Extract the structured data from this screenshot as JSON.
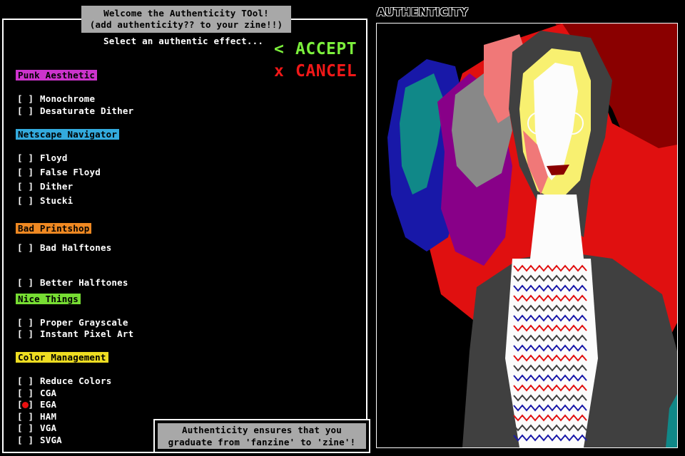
{
  "welcome": {
    "line1": "Welcome the Authenticity TOol!",
    "line2": "(add authenticity?? to your zine!!)"
  },
  "prompt": "Select an authentic effect...",
  "actions": {
    "accept_glyph": "<",
    "accept_label": "ACCEPT",
    "accept_color": "#7cf03c",
    "cancel_glyph": "x",
    "cancel_label": "CANCEL",
    "cancel_color": "#f01818"
  },
  "checkbox_text": "[ ]",
  "checkbox_checked_left": "[",
  "checkbox_checked_right": "]",
  "sections": [
    {
      "label": "Punk Aesthetic",
      "color": "#cc33cc"
    },
    {
      "label": "Netscape Navigator",
      "color": "#33aadd"
    },
    {
      "label": "Bad Printshop",
      "color": "#ee8822"
    },
    {
      "label": "Nice Things",
      "color": "#77dd33"
    },
    {
      "label": "Color Management",
      "color": "#eedd22"
    }
  ],
  "options": {
    "monochrome": {
      "label": "Monochrome",
      "checked": false
    },
    "desaturate_dither": {
      "label": "Desaturate Dither",
      "checked": false
    },
    "floyd": {
      "label": "Floyd",
      "checked": false
    },
    "false_floyd": {
      "label": "False Floyd",
      "checked": false
    },
    "dither": {
      "label": "Dither",
      "checked": false
    },
    "stucki": {
      "label": "Stucki",
      "checked": false
    },
    "bad_halftones": {
      "label": "Bad Halftones",
      "checked": false
    },
    "better_halftones": {
      "label": "Better Halftones",
      "checked": false
    },
    "proper_grayscale": {
      "label": "Proper Grayscale",
      "checked": false
    },
    "instant_pixel_art": {
      "label": "Instant Pixel Art",
      "checked": false
    },
    "reduce_colors": {
      "label": "Reduce Colors",
      "checked": false
    },
    "cga": {
      "label": "CGA",
      "checked": false
    },
    "ega": {
      "label": "EGA",
      "checked": true
    },
    "ham": {
      "label": "HAM",
      "checked": false
    },
    "vga": {
      "label": "VGA",
      "checked": false
    },
    "svga": {
      "label": "SVGA",
      "checked": false
    }
  },
  "footer": {
    "line1": "Authenticity ensures that you",
    "line2": "graduate from 'fanzine' to 'zine'!"
  },
  "brand": "AUTHENTICITY",
  "preview": {
    "alt": "preview-image",
    "palette": {
      "background": "#000000",
      "red": "#e01010",
      "dark_red": "#8a0000",
      "purple": "#880088",
      "blue": "#1818a8",
      "teal": "#108888",
      "gray": "#888888",
      "pink": "#f07878",
      "yellow": "#f8f070",
      "white": "#fcfcfc",
      "dark_gray": "#404040"
    }
  }
}
